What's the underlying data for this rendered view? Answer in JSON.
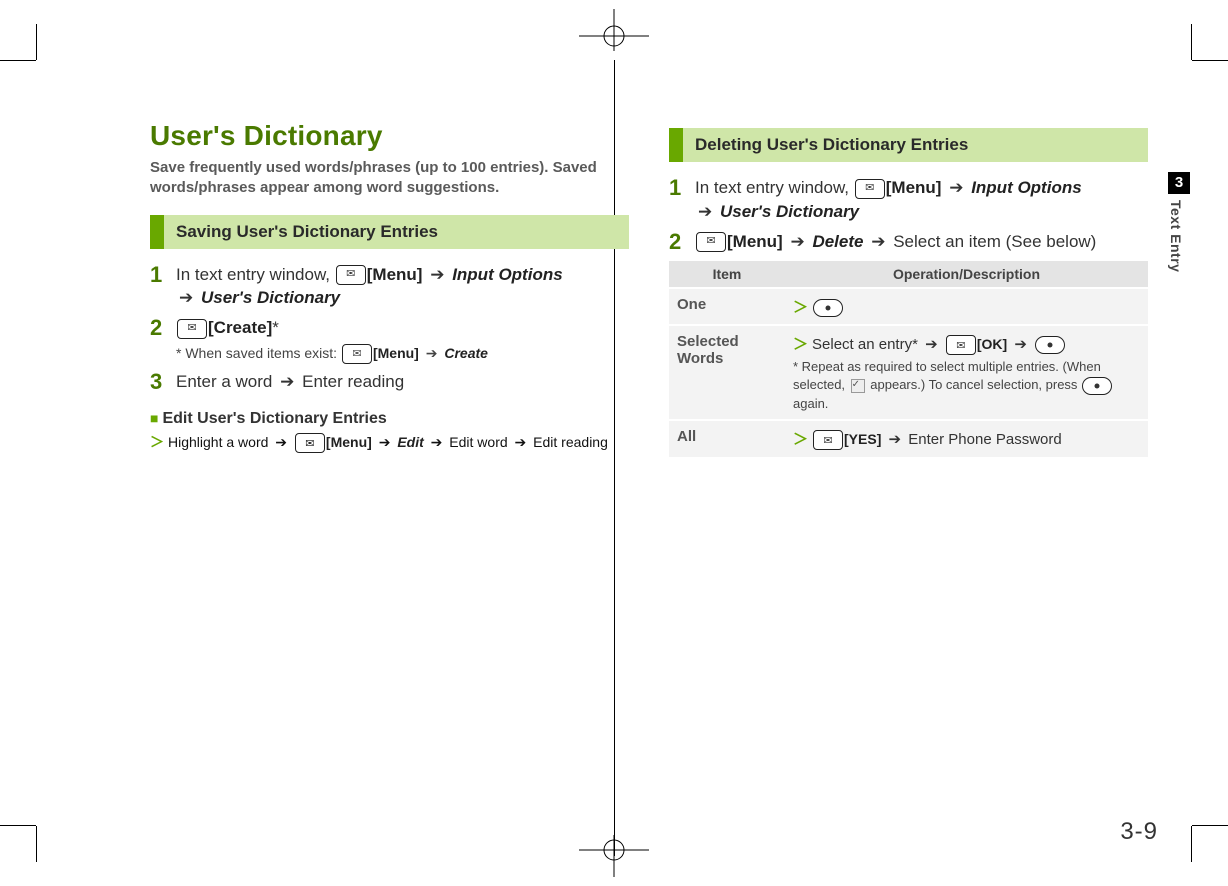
{
  "side_tab": {
    "number": "3",
    "label": "Text Entry"
  },
  "page_number": "3-9",
  "left": {
    "title": "User's Dictionary",
    "lead": "Save frequently used words/phrases (up to 100 entries). Saved words/phrases appear among word suggestions.",
    "section1": "Saving User's Dictionary Entries",
    "steps": [
      {
        "n": "1",
        "pre": "In text entry window, ",
        "menu": "[Menu]",
        "opt": "Input Options",
        "dict": "User's Dictionary"
      },
      {
        "n": "2",
        "create": "[Create]",
        "note_pre": "* When saved items exist: ",
        "menu": "[Menu]",
        "create2": "Create"
      },
      {
        "n": "3",
        "a": "Enter a word",
        "b": "Enter reading"
      }
    ],
    "edit": {
      "title": "Edit User's Dictionary Entries",
      "a": "Highlight a word",
      "menu": "[Menu]",
      "edit": "Edit",
      "b": "Edit word",
      "c": "Edit reading"
    }
  },
  "right": {
    "section1": "Deleting User's Dictionary Entries",
    "steps": [
      {
        "n": "1",
        "pre": "In text entry window, ",
        "menu": "[Menu]",
        "opt": "Input Options",
        "dict": "User's Dictionary"
      },
      {
        "n": "2",
        "menu": "[Menu]",
        "del": "Delete",
        "tail": "Select an item (See below)"
      }
    ],
    "table": {
      "headers": [
        "Item",
        "Operation/Description"
      ],
      "rows": [
        {
          "item": "One"
        },
        {
          "item": "Selected Words",
          "a": "Select an entry*",
          "ok": "[OK]",
          "fn1": "* Repeat as required to select multiple entries. (When selected, ",
          "fn2": " appears.) To cancel selection, press ",
          "fn3": " again."
        },
        {
          "item": "All",
          "yes": "[YES]",
          "tail": "Enter Phone Password"
        }
      ]
    }
  }
}
